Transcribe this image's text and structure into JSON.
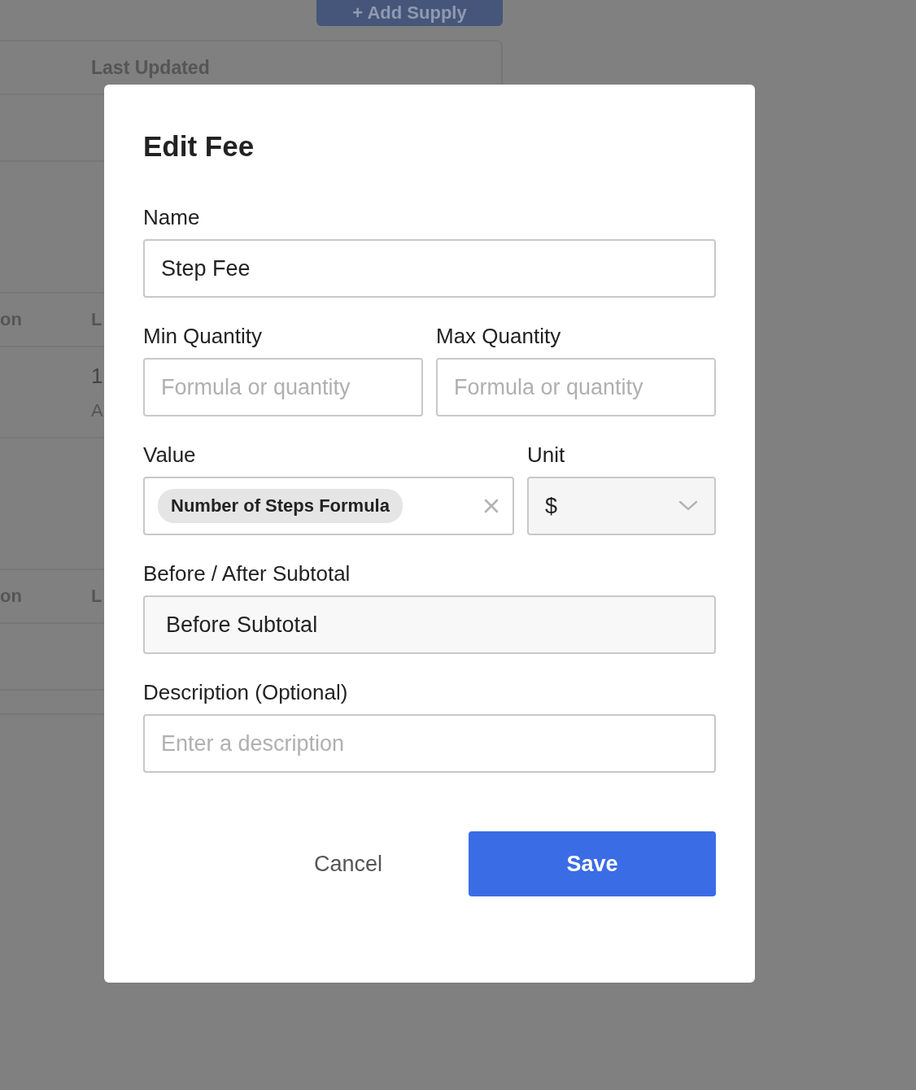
{
  "background": {
    "add_button": "+ Add Supply",
    "header": "Last Updated",
    "sections": [
      {
        "column_1": "on",
        "column_2": "L",
        "rows": [
          {
            "line_1": "1",
            "line_2": "A"
          }
        ]
      },
      {
        "column_1": "on",
        "column_2": "L"
      }
    ]
  },
  "dialog": {
    "title": "Edit Fee",
    "rows": [
      [
        {
          "kind": "text",
          "label": "Name",
          "value": "Step Fee"
        }
      ],
      [
        {
          "kind": "text",
          "label": "Min Quantity",
          "placeholder": "Formula or quantity"
        },
        {
          "kind": "text",
          "label": "Max Quantity",
          "placeholder": "Formula or quantity"
        }
      ],
      [
        {
          "kind": "chip",
          "label": "Value",
          "chip": "Number of Steps Formula"
        },
        {
          "kind": "select",
          "label": "Unit",
          "value": "$"
        }
      ],
      [
        {
          "kind": "static",
          "label": "Before / After Subtotal",
          "value": "Before Subtotal"
        }
      ],
      [
        {
          "kind": "text",
          "label": "Description (Optional)",
          "placeholder": "Enter a description"
        }
      ]
    ],
    "buttons": [
      {
        "kind": "secondary",
        "label": "Cancel"
      },
      {
        "kind": "primary",
        "label": "Save"
      }
    ]
  }
}
